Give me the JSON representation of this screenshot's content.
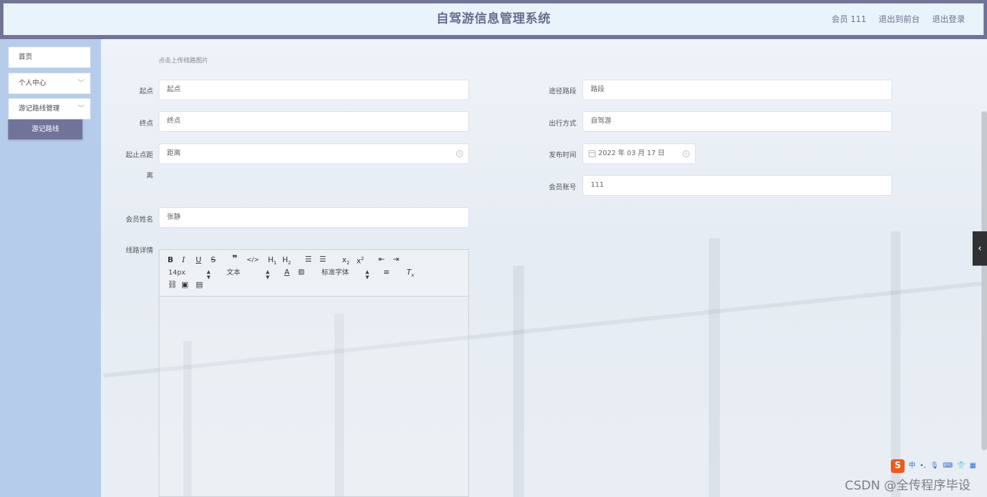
{
  "header": {
    "title": "自驾游信息管理系统",
    "member": "会员 111",
    "to_front": "退出到前台",
    "logout": "退出登录"
  },
  "sidebar": {
    "items": [
      {
        "label": "首页"
      },
      {
        "label": "个人中心"
      },
      {
        "label": "游记路线管理"
      }
    ],
    "active_sub": "游记路线"
  },
  "form": {
    "upload_hint": "点击上传线路图片",
    "start_label": "起点",
    "start_value": "起点",
    "route_label": "途径路段",
    "route_value": "路段",
    "end_label": "终点",
    "end_value": "终点",
    "travel_label": "出行方式",
    "travel_value": "自驾游",
    "distance_label_1": "起止点距",
    "distance_label_2": "离",
    "distance_value": "距离",
    "publish_label": "发布时间",
    "publish_value": "2022 年 03 月 17 日",
    "account_label": "会员账号",
    "account_value": "111",
    "name_label": "会员姓名",
    "name_value": "张静",
    "detail_label": "线路详情"
  },
  "editor": {
    "size_option": "14px",
    "text_option": "文本",
    "font_option": "标准字体"
  },
  "ime": {
    "logo": "S",
    "mode": "中"
  },
  "watermark": "CSDN @全传程序毕设"
}
